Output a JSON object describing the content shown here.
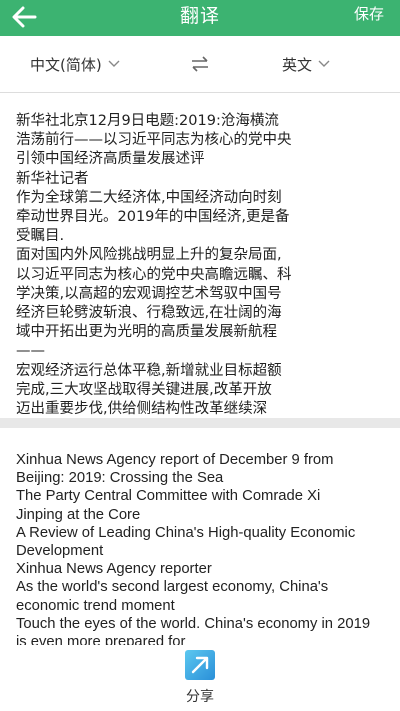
{
  "header": {
    "title": "翻译",
    "save_label": "保存"
  },
  "languages": {
    "source": "中文(简体)",
    "target": "英文"
  },
  "source_lines": [
    "新华社北京12月9日电题:2019:沧海横流",
    "浩荡前行——以习近平同志为核心的党中央",
    "引领中国经济高质量发展述评",
    "新华社记者",
    "作为全球第二大经济体,中国经济动向时刻",
    "牵动世界目光。2019年的中国经济,更是备",
    "受瞩目.",
    "面对国内外风险挑战明显上升的复杂局面,",
    "以习近平同志为核心的党中央高瞻远瞩、科",
    "学决策,以高超的宏观调控艺术驾驭中国号",
    "经济巨轮劈波斩浪、行稳致远,在壮阔的海",
    "域中开拓出更为光明的高质量发展新航程",
    "——",
    "宏观经济运行总体平稳,新增就业目标超额",
    "完成,三大攻坚战取得关键进展,改革开放",
    "迈出重要步伐,供给侧结构性改革继续深"
  ],
  "result_lines": [
    "Xinhua News Agency report of December 9 from",
    "Beijing: 2019: Crossing the Sea",
    "The Party Central Committee with Comrade Xi",
    "Jinping at the Core",
    "A Review of Leading China's High-quality Economic",
    "Development",
    "Xinhua News Agency reporter",
    "As the world's second largest economy, China's",
    "economic trend moment",
    "Touch the eyes of the world. China's economy in 2019",
    "is even more prepared for"
  ],
  "footer": {
    "share_label": "分享"
  },
  "colors": {
    "header_bg": "#3cb371",
    "share_icon": "#2a8fd8"
  }
}
